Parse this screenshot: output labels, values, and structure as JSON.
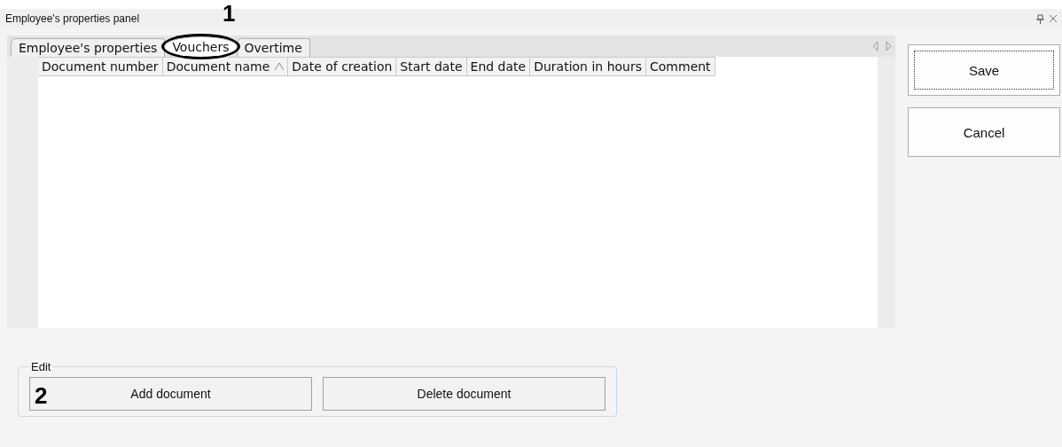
{
  "panel": {
    "title": "Employee's properties panel"
  },
  "tabs": [
    {
      "label": "Employee's properties",
      "selected": false
    },
    {
      "label": "Vouchers",
      "selected": true
    },
    {
      "label": "Overtime",
      "selected": false
    }
  ],
  "table": {
    "columns": [
      {
        "label": "Document number",
        "sorted": false
      },
      {
        "label": "Document name",
        "sorted": true
      },
      {
        "label": "Date of creation",
        "sorted": false
      },
      {
        "label": "Start date",
        "sorted": false
      },
      {
        "label": "End date",
        "sorted": false
      },
      {
        "label": "Duration in hours",
        "sorted": false
      },
      {
        "label": "Comment",
        "sorted": false
      }
    ]
  },
  "actions": [
    {
      "label": "Save",
      "focused": true
    },
    {
      "label": "Cancel",
      "focused": false
    }
  ],
  "edit_group": {
    "title": "Edit",
    "buttons": [
      {
        "label": "Add document"
      },
      {
        "label": "Delete document"
      }
    ]
  },
  "annotations": [
    {
      "label": "1"
    },
    {
      "label": "2"
    }
  ]
}
